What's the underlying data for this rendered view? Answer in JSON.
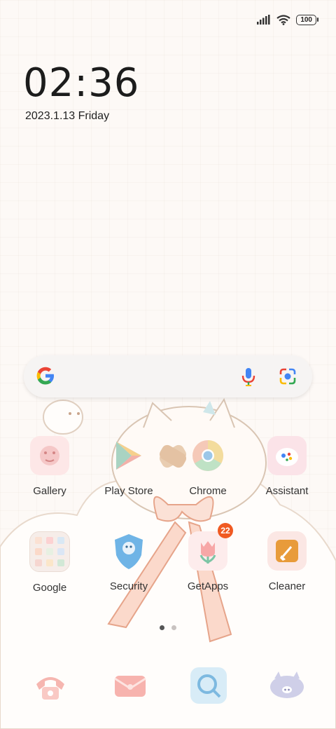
{
  "status_bar": {
    "battery_level": "100",
    "signal_icon": "signal-bars-icon",
    "wifi_icon": "wifi-icon"
  },
  "lockscreen_clock": {
    "time": "02:36",
    "date": "2023.1.13 Friday"
  },
  "search_widget": {
    "logo_icon": "google-g-icon",
    "voice_icon": "microphone-icon",
    "lens_icon": "google-lens-icon"
  },
  "apps": [
    {
      "label": "Gallery",
      "icon": "gallery-icon"
    },
    {
      "label": "Play Store",
      "icon": "play-store-icon"
    },
    {
      "label": "Chrome",
      "icon": "chrome-icon"
    },
    {
      "label": "Assistant",
      "icon": "assistant-icon"
    },
    {
      "label": "Google",
      "icon": "google-folder-icon"
    },
    {
      "label": "Security",
      "icon": "security-icon"
    },
    {
      "label": "GetApps",
      "icon": "getapps-icon",
      "badge": "22"
    },
    {
      "label": "Cleaner",
      "icon": "cleaner-icon"
    }
  ],
  "page_indicator": {
    "pages": 2,
    "current": 1
  },
  "dock": [
    {
      "icon": "phone-icon"
    },
    {
      "icon": "messages-icon"
    },
    {
      "icon": "camera-search-icon"
    },
    {
      "icon": "pig-browser-icon"
    }
  ],
  "colors": {
    "accent_badge": "#f05a22",
    "background": "#fdf9f6",
    "text": "#333333"
  }
}
